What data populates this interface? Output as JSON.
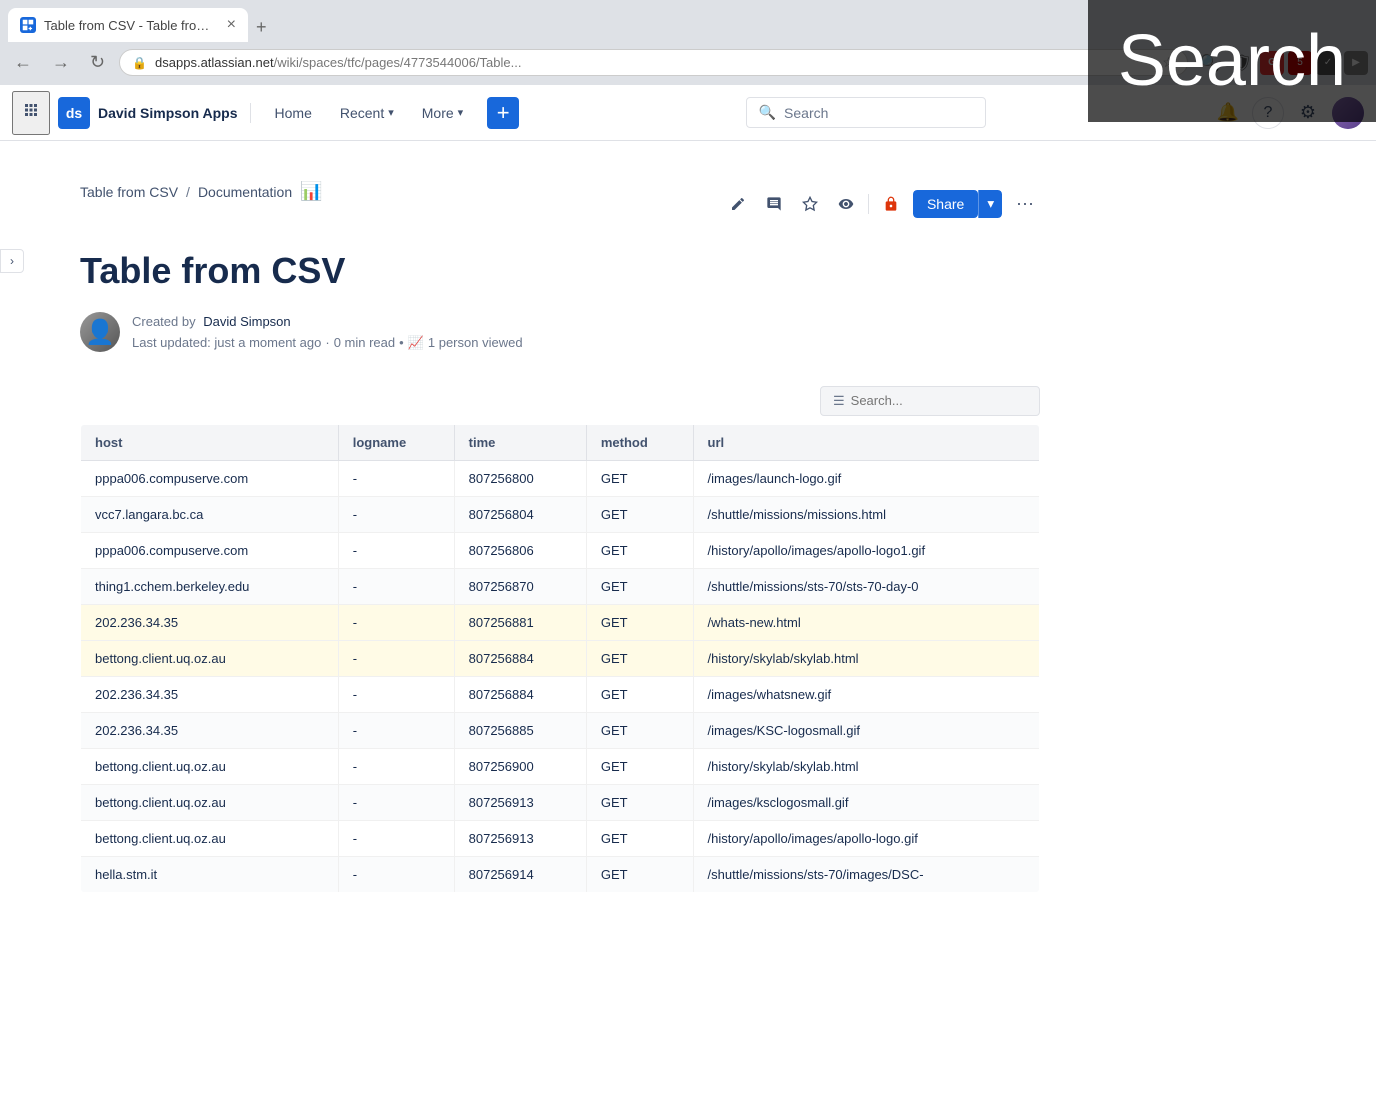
{
  "browser": {
    "tab_title": "Table from CSV - Table from C",
    "tab_favicon": "ds",
    "url_display": "dsapps.atlassian.net/wiki/spaces/tfc/pages/4773544006/Table...",
    "url_domain": "dsapps.atlassian.net",
    "url_path": "/wiki/spaces/tfc/pages/4773544006/Table...",
    "new_tab_label": "+"
  },
  "search_overlay": {
    "text": "Search"
  },
  "header": {
    "app_logo": "ds",
    "app_name": "David Simpson Apps",
    "nav_items": [
      {
        "label": "Home",
        "id": "home"
      },
      {
        "label": "Recent",
        "id": "recent",
        "has_dropdown": true
      },
      {
        "label": "More",
        "id": "more",
        "has_dropdown": true
      }
    ],
    "create_label": "+",
    "search_placeholder": "Search",
    "notification_icon": "🔔",
    "help_icon": "?",
    "settings_icon": "⚙"
  },
  "breadcrumb": {
    "items": [
      {
        "label": "Table from CSV",
        "href": "#"
      },
      {
        "label": "Documentation",
        "href": "#"
      }
    ],
    "separator": "/"
  },
  "page": {
    "title": "Table from CSV",
    "author_name": "David Simpson",
    "created_by_label": "Created by",
    "last_updated": "Last updated: just a moment ago",
    "read_time": "0 min read",
    "views": "1 person viewed",
    "views_separator": "•"
  },
  "table_search": {
    "placeholder": "Search..."
  },
  "table": {
    "columns": [
      "host",
      "logname",
      "time",
      "method",
      "url"
    ],
    "rows": [
      {
        "host": "pppa006.compuserve.com",
        "logname": "-",
        "time": "807256800",
        "method": "GET",
        "url": "/images/launch-logo.gif",
        "highlight": false
      },
      {
        "host": "vcc7.langara.bc.ca",
        "logname": "-",
        "time": "807256804",
        "method": "GET",
        "url": "/shuttle/missions/missions.html",
        "highlight": false
      },
      {
        "host": "pppa006.compuserve.com",
        "logname": "-",
        "time": "807256806",
        "method": "GET",
        "url": "/history/apollo/images/apollo-logo1.gif",
        "highlight": false
      },
      {
        "host": "thing1.cchem.berkeley.edu",
        "logname": "-",
        "time": "807256870",
        "method": "GET",
        "url": "/shuttle/missions/sts-70/sts-70-day-0",
        "highlight": false
      },
      {
        "host": "202.236.34.35",
        "logname": "-",
        "time": "807256881",
        "method": "GET",
        "url": "/whats-new.html",
        "highlight": true
      },
      {
        "host": "bettong.client.uq.oz.au",
        "logname": "-",
        "time": "807256884",
        "method": "GET",
        "url": "/history/skylab/skylab.html",
        "highlight": true
      },
      {
        "host": "202.236.34.35",
        "logname": "-",
        "time": "807256884",
        "method": "GET",
        "url": "/images/whatsnew.gif",
        "highlight": false
      },
      {
        "host": "202.236.34.35",
        "logname": "-",
        "time": "807256885",
        "method": "GET",
        "url": "/images/KSC-logosmall.gif",
        "highlight": false
      },
      {
        "host": "bettong.client.uq.oz.au",
        "logname": "-",
        "time": "807256900",
        "method": "GET",
        "url": "/history/skylab/skylab.html",
        "highlight": false
      },
      {
        "host": "bettong.client.uq.oz.au",
        "logname": "-",
        "time": "807256913",
        "method": "GET",
        "url": "/images/ksclogosmall.gif",
        "highlight": false
      },
      {
        "host": "bettong.client.uq.oz.au",
        "logname": "-",
        "time": "807256913",
        "method": "GET",
        "url": "/history/apollo/images/apollo-logo.gif",
        "highlight": false
      },
      {
        "host": "hella.stm.it",
        "logname": "-",
        "time": "807256914",
        "method": "GET",
        "url": "/shuttle/missions/sts-70/images/DSC-",
        "highlight": false
      }
    ]
  },
  "actions": {
    "edit_icon": "✏️",
    "comment_icon": "💬",
    "star_icon": "☆",
    "watch_icon": "👁",
    "lock_icon": "🔒",
    "share_label": "Share",
    "more_icon": "···"
  }
}
